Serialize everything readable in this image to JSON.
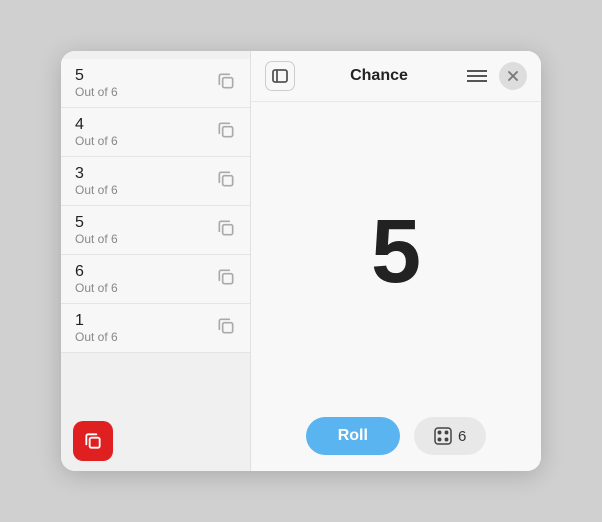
{
  "window": {
    "title": "Chance"
  },
  "header": {
    "title": "Chance",
    "left_icon": "sidebar-icon",
    "menu_icon": "menu-icon",
    "close_icon": "close-icon"
  },
  "list": {
    "items": [
      {
        "number": "5",
        "label": "Out of 6"
      },
      {
        "number": "4",
        "label": "Out of 6"
      },
      {
        "number": "3",
        "label": "Out of 6"
      },
      {
        "number": "5",
        "label": "Out of 6"
      },
      {
        "number": "6",
        "label": "Out of 6"
      },
      {
        "number": "1",
        "label": "Out of 6"
      }
    ]
  },
  "main": {
    "big_number": "5"
  },
  "footer": {
    "roll_label": "Roll",
    "dice_value": "6"
  }
}
